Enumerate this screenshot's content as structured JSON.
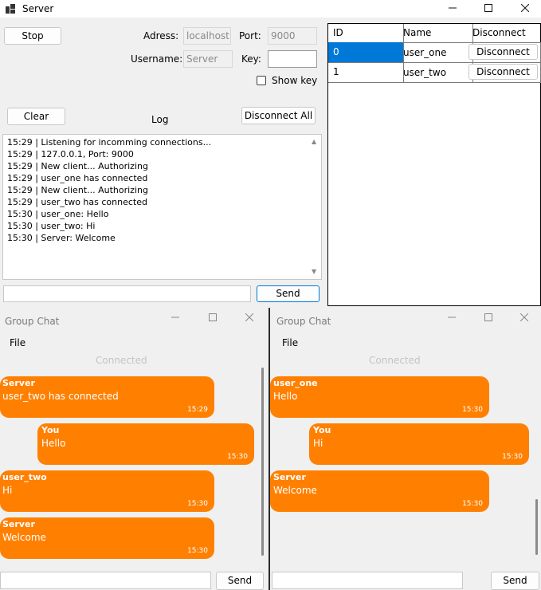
{
  "server": {
    "title": "Server",
    "stop_label": "Stop",
    "address_label": "Adress:",
    "address_value": "localhost",
    "port_label": "Port:",
    "port_value": "9000",
    "username_label": "Username:",
    "username_value": "Server",
    "key_label": "Key:",
    "key_value": "",
    "show_key_label": "Show key",
    "show_key_checked": false,
    "clear_label": "Clear",
    "log_label": "Log",
    "disconnect_all_label": "Disconnect All",
    "log_lines": [
      "15:29 | Listening for incomming connections...",
      "15:29 | 127.0.0.1, Port: 9000",
      "15:29 | New client... Authorizing",
      "15:29 | user_one has connected",
      "15:29 | New client... Authorizing",
      "15:29 | user_two has connected",
      "15:30 | user_one: Hello",
      "15:30 | user_two: Hi",
      "15:30 | Server: Welcome"
    ],
    "message_value": "",
    "send_label": "Send",
    "clients_table": {
      "headers": [
        "ID",
        "Name",
        "Disconnect"
      ],
      "rows": [
        {
          "id": "0",
          "name": "user_one",
          "action": "Disconnect",
          "selected": true
        },
        {
          "id": "1",
          "name": "user_two",
          "action": "Disconnect",
          "selected": false
        }
      ]
    },
    "selection_color": "#0078d7"
  },
  "chat_left": {
    "title": "Group Chat",
    "menu_file": "File",
    "status": "Connected",
    "messages": [
      {
        "sender": "Server",
        "text": "user_two has connected",
        "time": "15:29",
        "own": false
      },
      {
        "sender": "You",
        "text": "Hello",
        "time": "15:30",
        "own": true
      },
      {
        "sender": "user_two",
        "text": "Hi",
        "time": "15:30",
        "own": false
      },
      {
        "sender": "Server",
        "text": "Welcome",
        "time": "15:30",
        "own": false
      }
    ],
    "input_value": "",
    "send_label": "Send"
  },
  "chat_right": {
    "title": "Group Chat",
    "menu_file": "File",
    "status": "Connected",
    "messages": [
      {
        "sender": "user_one",
        "text": "Hello",
        "time": "15:30",
        "own": false
      },
      {
        "sender": "You",
        "text": "Hi",
        "time": "15:30",
        "own": true
      },
      {
        "sender": "Server",
        "text": "Welcome",
        "time": "15:30",
        "own": false
      }
    ],
    "input_value": "",
    "send_label": "Send"
  },
  "colors": {
    "bubble": "#ff8000",
    "window_bg": "#f0f0f0"
  },
  "icons": {
    "minimize": "minimize-icon",
    "maximize": "maximize-icon",
    "close": "close-icon",
    "app": "app-icon"
  }
}
